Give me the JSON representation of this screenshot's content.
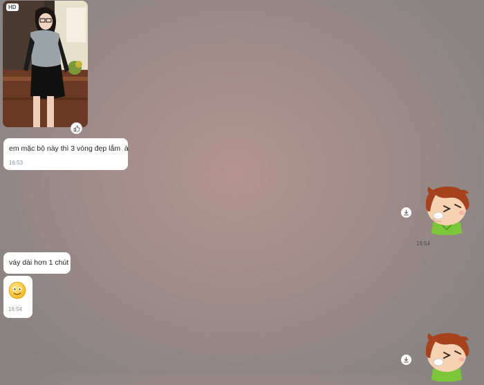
{
  "photo_message": {
    "badge": "HD",
    "like_icon": "thumbs-up-icon"
  },
  "messages": [
    {
      "text": "em mặc bộ này thì 3 vòng đẹp lắm  à",
      "time": "16:53"
    },
    {
      "text": "váy dài hơn 1 chút"
    },
    {
      "emoji": "smiley-emoji",
      "time": "16:54"
    }
  ],
  "outgoing": {
    "sticker": "sneezing-boy-sticker",
    "download_icon": "download-icon",
    "time": "16:54"
  },
  "colors": {
    "bubble": "#ffffff",
    "timestamp": "#8a8f96"
  }
}
